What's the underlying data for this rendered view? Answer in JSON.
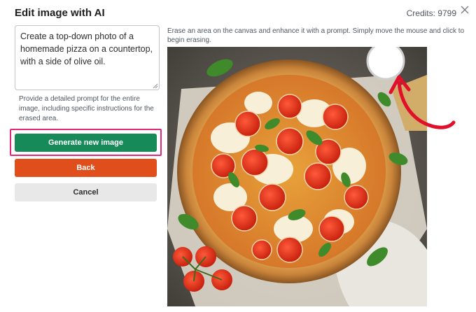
{
  "dialog": {
    "title": "Edit image with AI",
    "credits_label": "Credits: 9799",
    "close_icon": "close-icon"
  },
  "prompt": {
    "value": "Create a top-down photo of a homemade pizza on a countertop, with a side of olive oil.",
    "help": "Provide a detailed prompt for the entire image, including specific instructions for the erased area."
  },
  "buttons": {
    "generate": "Generate new image",
    "back": "Back",
    "cancel": "Cancel"
  },
  "canvas": {
    "instruction": "Erase an area on the canvas and enhance it with a prompt. Simply move the mouse and click to begin erasing.",
    "image_subject": "pizza-margherita-photo"
  },
  "colors": {
    "generate": "#178a5a",
    "back": "#e04e1b",
    "cancel": "#e8e8e8",
    "highlight": "#e0287a",
    "arrow": "#e0102a"
  }
}
